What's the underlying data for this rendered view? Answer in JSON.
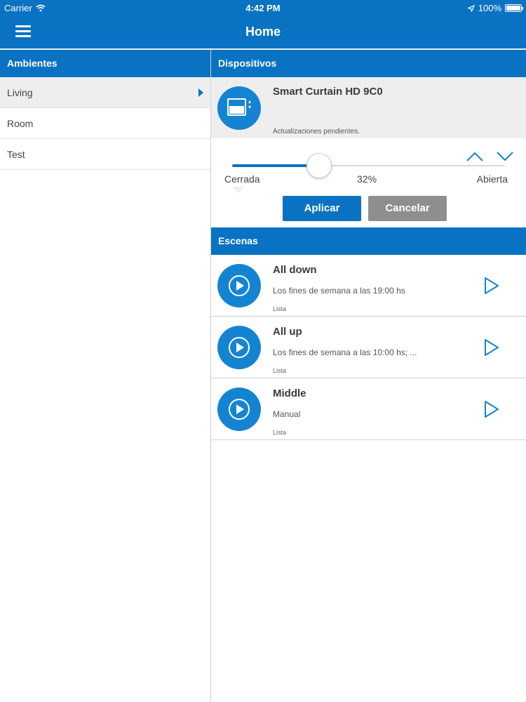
{
  "status_bar": {
    "carrier": "Carrier",
    "time": "4:42 PM",
    "battery": "100%"
  },
  "nav": {
    "title": "Home",
    "menu_icon": "hamburger-menu-icon"
  },
  "rooms": {
    "header": "Ambientes",
    "items": [
      {
        "label": "Living",
        "selected": true
      },
      {
        "label": "Room"
      },
      {
        "label": "Test"
      }
    ]
  },
  "devices": {
    "header": "Dispositivos",
    "device": {
      "name": "Smart Curtain HD 9C0",
      "status": "Actualizaciones pendientes.",
      "icon": "curtain-icon"
    },
    "slider": {
      "min_label": "Cerrada",
      "value_label": "32%",
      "max_label": "Abierta",
      "value": 0.32
    },
    "apply_label": "Aplicar",
    "cancel_label": "Cancelar"
  },
  "scenes": {
    "header": "Escenas",
    "items": [
      {
        "name": "All down",
        "schedule": "Los fines de semana a las 19:00 hs",
        "state": "Lista"
      },
      {
        "name": "All up",
        "schedule": "Los fines de semana a las 10:00 hs; ...",
        "state": "Lista"
      },
      {
        "name": "Middle",
        "schedule": "Manual",
        "state": "Lista"
      }
    ]
  },
  "colors": {
    "accent": "#0a72c2",
    "icon_bg": "#1484d2",
    "cancel_bg": "#8e8e8e"
  }
}
